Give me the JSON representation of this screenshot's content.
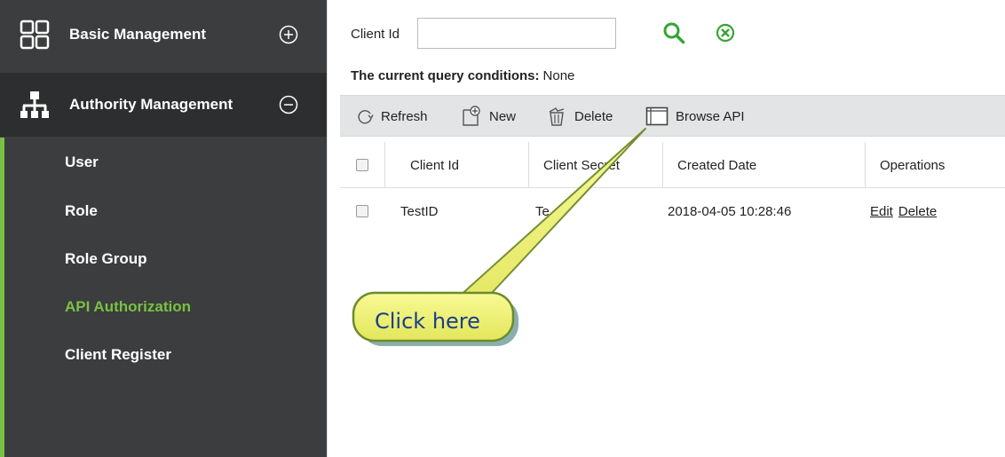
{
  "sidebar": {
    "sections": [
      {
        "label": "Basic Management",
        "icon": "grid-icon",
        "toggle": "plus-circle-icon"
      },
      {
        "label": "Authority Management",
        "icon": "org-chart-icon",
        "toggle": "minus-circle-icon"
      }
    ],
    "items": [
      {
        "label": "User"
      },
      {
        "label": "Role"
      },
      {
        "label": "Role Group"
      },
      {
        "label": "API Authorization",
        "active": true
      },
      {
        "label": "Client Register"
      }
    ],
    "accent_color": "#7ac143"
  },
  "search": {
    "label": "Client Id",
    "value": "",
    "query_conditions_label": "The current query conditions:",
    "query_conditions_value": "None"
  },
  "toolbar": {
    "refresh_label": "Refresh",
    "new_label": "New",
    "delete_label": "Delete",
    "browse_api_label": "Browse API"
  },
  "table": {
    "columns": [
      "Client Id",
      "Client Secret",
      "Created Date",
      "Operations"
    ],
    "rows": [
      {
        "client_id": "TestID",
        "client_secret": "Te",
        "created_date": "2018-04-05 10:28:46",
        "edit_label": "Edit",
        "delete_label": "Delete"
      }
    ]
  },
  "callout": {
    "text": "Click here",
    "fill_color": "#f2f472"
  }
}
